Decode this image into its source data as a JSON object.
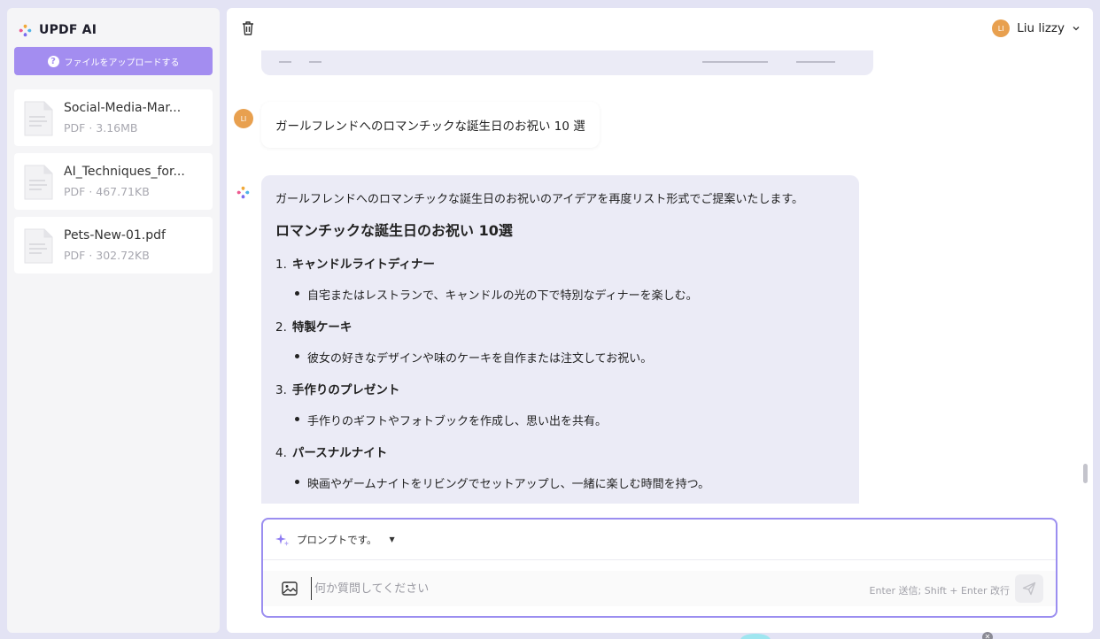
{
  "app": {
    "name": "UPDF AI"
  },
  "sidebar": {
    "upload_label": "ファイルをアップロードする",
    "files": [
      {
        "name": "Social-Media-Mar...",
        "meta": "PDF · 3.16MB"
      },
      {
        "name": "AI_Techniques_for...",
        "meta": "PDF · 467.71KB"
      },
      {
        "name": "Pets-New-01.pdf",
        "meta": "PDF · 302.72KB"
      }
    ]
  },
  "header": {
    "user_initials": "LI",
    "user_name": "Liu lizzy"
  },
  "chat": {
    "user_message": "ガールフレンドへのロマンチックな誕生日のお祝い 10 選",
    "ai_intro": "ガールフレンドへのロマンチックな誕生日のお祝いのアイデアを再度リスト形式でご提案いたします。",
    "ai_heading": "ロマンチックな誕生日のお祝い 10選",
    "items": [
      {
        "num": "1.",
        "title": "キャンドルライトディナー",
        "detail": "自宅またはレストランで、キャンドルの光の下で特別なディナーを楽しむ。"
      },
      {
        "num": "2.",
        "title": "特製ケーキ",
        "detail": "彼女の好きなデザインや味のケーキを自作または注文してお祝い。"
      },
      {
        "num": "3.",
        "title": "手作りのプレゼント",
        "detail": "手作りのギフトやフォトブックを作成し、思い出を共有。"
      },
      {
        "num": "4.",
        "title": "パースナルナイト",
        "detail": "映画やゲームナイトをリビングでセットアップし、一緒に楽しむ時間を持つ。"
      }
    ]
  },
  "prompt": {
    "mode_label": "プロンプトです。",
    "input_placeholder": "何か質問してください",
    "input_value": "",
    "shortcut_hint": "Enter 送信; Shift + Enter 改行"
  },
  "colors": {
    "accent": "#a38df0",
    "prompt_border": "#9b8ef0",
    "ai_bubble": "#ebebf6",
    "avatar": "#e8a04f"
  }
}
